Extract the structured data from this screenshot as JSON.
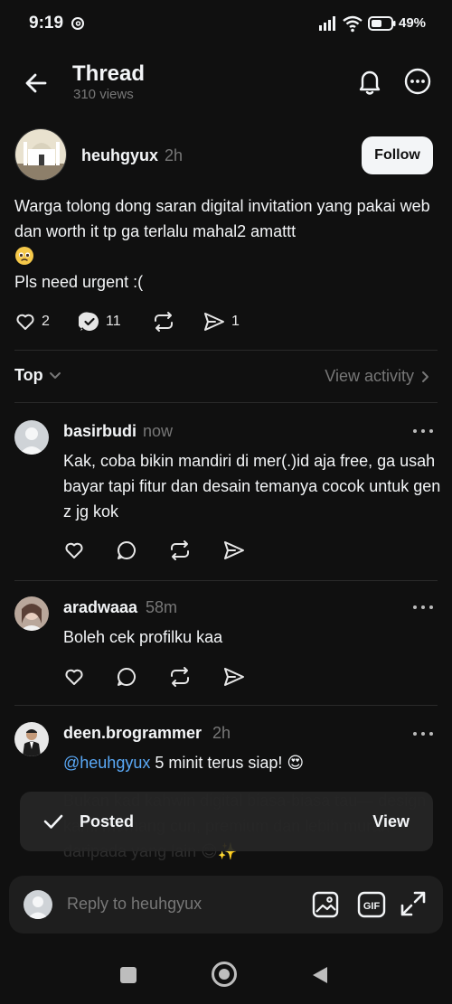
{
  "status_bar": {
    "time": "9:19",
    "battery_pct": "49%",
    "icons": [
      "threads-icon",
      "signal-icon",
      "wifi-icon",
      "battery-icon"
    ]
  },
  "header": {
    "title": "Thread",
    "views": "310 views",
    "icons": [
      "back-arrow-icon",
      "bell-icon",
      "more-options-icon"
    ]
  },
  "post": {
    "username": "heuhgyux",
    "time": "2h",
    "follow_label": "Follow",
    "text_line1": "Warga tolong dong saran digital invitation yang pakai web dan worth it tp ga terlalu mahal2 amattt",
    "text_line2": "Pls need urgent :(",
    "likes": "2",
    "replies": "11",
    "shares": "1"
  },
  "sort": {
    "label": "Top",
    "activity": "View activity"
  },
  "comments": [
    {
      "username": "basirbudi",
      "time": "now",
      "text": "Kak, coba bikin mandiri di mer(.)id aja free, ga usah bayar tapi fitur dan desain temanya cocok untuk gen z jg kok"
    },
    {
      "username": "aradwaaa",
      "time": "58m",
      "text": "Boleh cek profilku kaa"
    },
    {
      "username": "deen.brogrammer",
      "time": "2h",
      "mention": "@heuhgyux",
      "text": " 5 minit terus siap! 😍",
      "faded_text": "Bukan kad kahwin digital biasa-biasa tau— design kami memang cun, premium dan lebih murah daripada yang lain 😊✨"
    }
  ],
  "toast": {
    "label": "Posted",
    "action": "View"
  },
  "reply_bar": {
    "placeholder": "Reply to heuhgyux",
    "gif_label": "GIF"
  },
  "colors": {
    "background": "#101010",
    "text": "#f3f5f7",
    "secondary_text": "#777777",
    "mention": "#5aa9f7",
    "divider": "#2a2a2a"
  }
}
